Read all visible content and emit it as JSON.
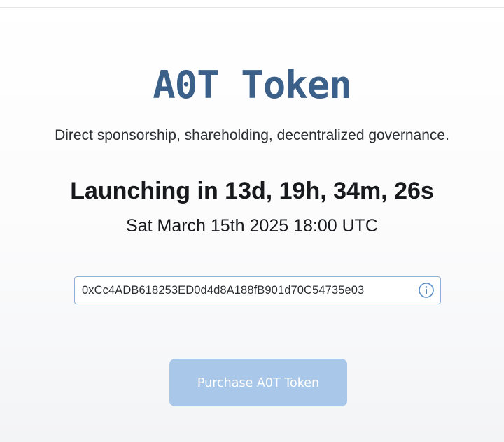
{
  "header": {
    "title": "A0T Token",
    "tagline": "Direct sponsorship, shareholding, decentralized governance."
  },
  "launch": {
    "countdown": "Launching in 13d, 19h, 34m, 26s",
    "date": "Sat March 15th 2025 18:00 UTC"
  },
  "contract": {
    "address": "0xCc4ADB618253ED0d4d8A188fB901d70C54735e03",
    "info_icon": "info-circle-icon"
  },
  "purchase": {
    "label": "Purchase A0T Token",
    "disabled": true
  },
  "colors": {
    "title": "#3b6089",
    "border_accent": "#8fb0d3",
    "button_disabled": "#a9c7e8"
  }
}
